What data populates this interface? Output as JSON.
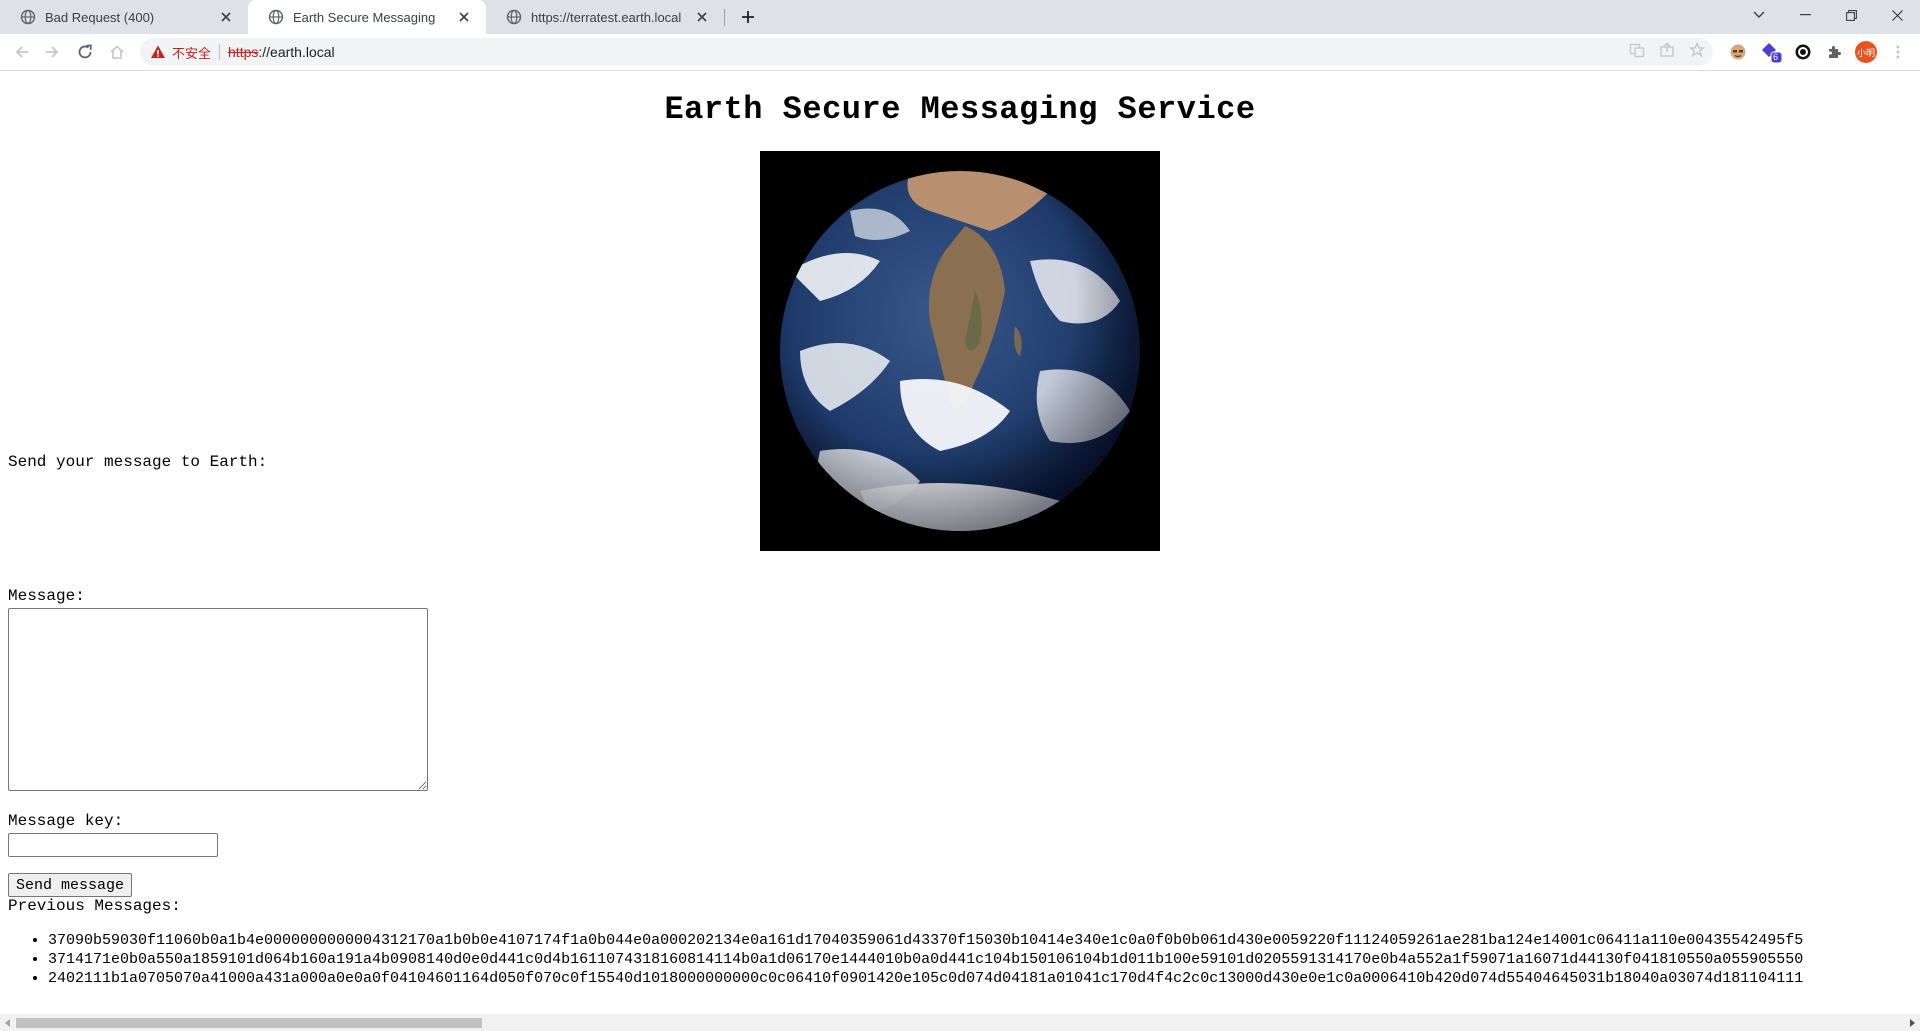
{
  "browser": {
    "tabs": [
      {
        "title": "Bad Request (400)",
        "active": false
      },
      {
        "title": "Earth Secure Messaging",
        "active": true
      },
      {
        "title": "https://terratest.earth.local",
        "active": false
      }
    ],
    "address_bar": {
      "security_label": "不安全",
      "url_scheme": "https",
      "url_rest": "://earth.local"
    },
    "extension_badge": "6",
    "profile_label": "小明"
  },
  "page": {
    "title": "Earth Secure Messaging Service",
    "image_alt_icon": "earth-globe-photo",
    "send_prompt": "Send your message to Earth:",
    "message_label": "Message:",
    "message_value": "",
    "key_label": "Message key:",
    "key_value": "",
    "send_button": "Send message",
    "previous_label": "Previous Messages:",
    "previous_messages": [
      "37090b59030f11060b0a1b4e0000000000004312170a1b0b0e4107174f1a0b044e0a000202134e0a161d17040359061d43370f15030b10414e340e1c0a0f0b0b061d430e0059220f11124059261ae281ba124e14001c06411a110e00435542495f5",
      "3714171e0b0a550a1859101d064b160a191a4b0908140d0e0d441c0d4b1611074318160814114b0a1d06170e1444010b0a0d441c104b150106104b1d011b100e59101d0205591314170e0b4a552a1f59071a16071d44130f041810550a055905550",
      "2402111b1a0705070a41000a431a000a0e0a0f04104601164d050f070c0f15540d1018000000000c0c06410f0901420e105c0d074d04181a01041c170d4f4c2c0c13000d430e0e1c0a0006410b420d074d55404645031b18040a03074d181104111"
    ]
  },
  "colors": {
    "tabstrip_bg": "#dee1e6",
    "insecure_red": "#c5221f",
    "profile_orange": "#e8541e",
    "extension_purple": "#4b3fd6"
  }
}
